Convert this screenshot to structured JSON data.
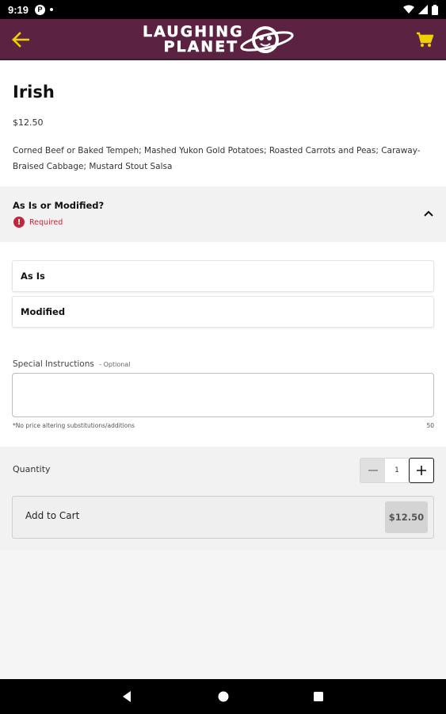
{
  "status_bar": {
    "time": "9:19",
    "notification_icon": "P"
  },
  "app_bar": {
    "logo_line1": "LAUGHING",
    "logo_line2": "PLANET",
    "back_icon": "arrow-left-icon",
    "cart_icon": "shopping-cart-icon",
    "accent_color": "#f0d000",
    "brand_color": "#5b2341"
  },
  "item": {
    "title": "Irish",
    "price": "$12.50",
    "description": "Corned Beef or Baked Tempeh; Mashed Yukon Gold Potatoes; Roasted Carrots and Peas; Caraway-Braised Cabbage; Mustard Stout Salsa"
  },
  "modifier_group": {
    "title": "As Is or Modified?",
    "required_label": "Required",
    "required_color": "#c0283a",
    "options": [
      {
        "label": "As Is"
      },
      {
        "label": "Modified"
      }
    ]
  },
  "special_instructions": {
    "label": "Special Instructions",
    "optional_label": "- Optional",
    "value": "",
    "hint": "*No price altering substitutions/additions",
    "char_limit": "50"
  },
  "quantity": {
    "label": "Quantity",
    "value": "1"
  },
  "add_to_cart": {
    "label": "Add to Cart",
    "price": "$12.50"
  }
}
